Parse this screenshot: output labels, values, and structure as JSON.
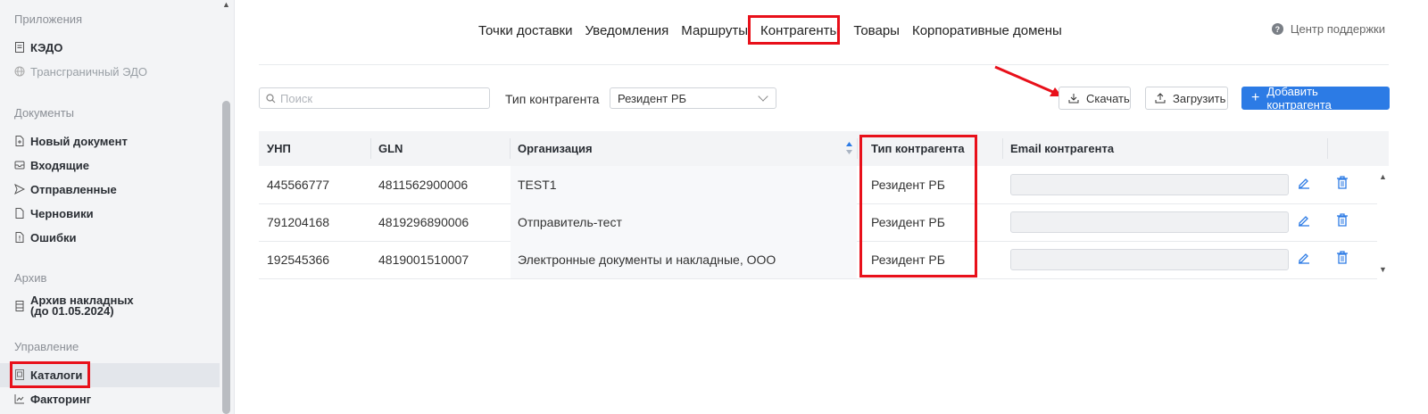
{
  "sidebar": {
    "sections": [
      {
        "title": "Приложения"
      },
      {
        "title": "Документы"
      },
      {
        "title": "Архив"
      },
      {
        "title": "Управление"
      }
    ],
    "items": {
      "kedo": "КЭДО",
      "cross_border": "Трансграничный ЭДО",
      "new_doc": "Новый документ",
      "incoming": "Входящие",
      "sent": "Отправленные",
      "drafts": "Черновики",
      "errors": "Ошибки",
      "archive_line1": "Архив накладных",
      "archive_line2": "(до 01.05.2024)",
      "catalogs": "Каталоги",
      "factoring": "Факторинг"
    }
  },
  "topnav": {
    "tabs": [
      "Точки доставки",
      "Уведомления",
      "Маршруты",
      "Контрагенты",
      "Товары",
      "Корпоративные домены"
    ],
    "active": "Контрагенты"
  },
  "support": {
    "label": "Центр поддержки",
    "icon": "question-icon"
  },
  "toolbar": {
    "search_placeholder": "Поиск",
    "type_label": "Тип контрагента",
    "type_value": "Резидент РБ",
    "download_label": "Скачать",
    "upload_label": "Загрузить",
    "add_label": "Добавить контрагента"
  },
  "table": {
    "columns": [
      "УНП",
      "GLN",
      "Организация",
      "Тип контрагента",
      "Email контрагента"
    ],
    "rows": [
      {
        "unp": "445566777",
        "gln": "4811562900006",
        "org": "TEST1",
        "type": "Резидент РБ",
        "email": ""
      },
      {
        "unp": "791204168",
        "gln": "4819296890006",
        "org": "Отправитель-тест",
        "type": "Резидент РБ",
        "email": ""
      },
      {
        "unp": "192545366",
        "gln": "4819001510007",
        "org": "Электронные документы и накладные, ООО",
        "type": "Резидент РБ",
        "email": ""
      }
    ]
  },
  "colors": {
    "accent": "#2c7be5",
    "highlight": "#e8101a"
  }
}
